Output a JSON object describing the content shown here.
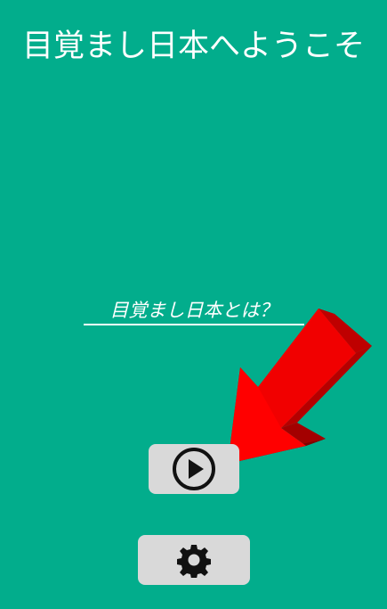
{
  "header": {
    "title": "目覚まし日本へようこそ"
  },
  "main": {
    "about_link_label": "目覚まし日本とは？",
    "play_icon": "play-circle-icon",
    "settings_icon": "gear-icon",
    "pointer_icon": "red-arrow-icon"
  },
  "colors": {
    "background": "#02ad8c",
    "button": "#d9d9d9",
    "text": "#ffffff",
    "arrow": "#ff0000"
  }
}
